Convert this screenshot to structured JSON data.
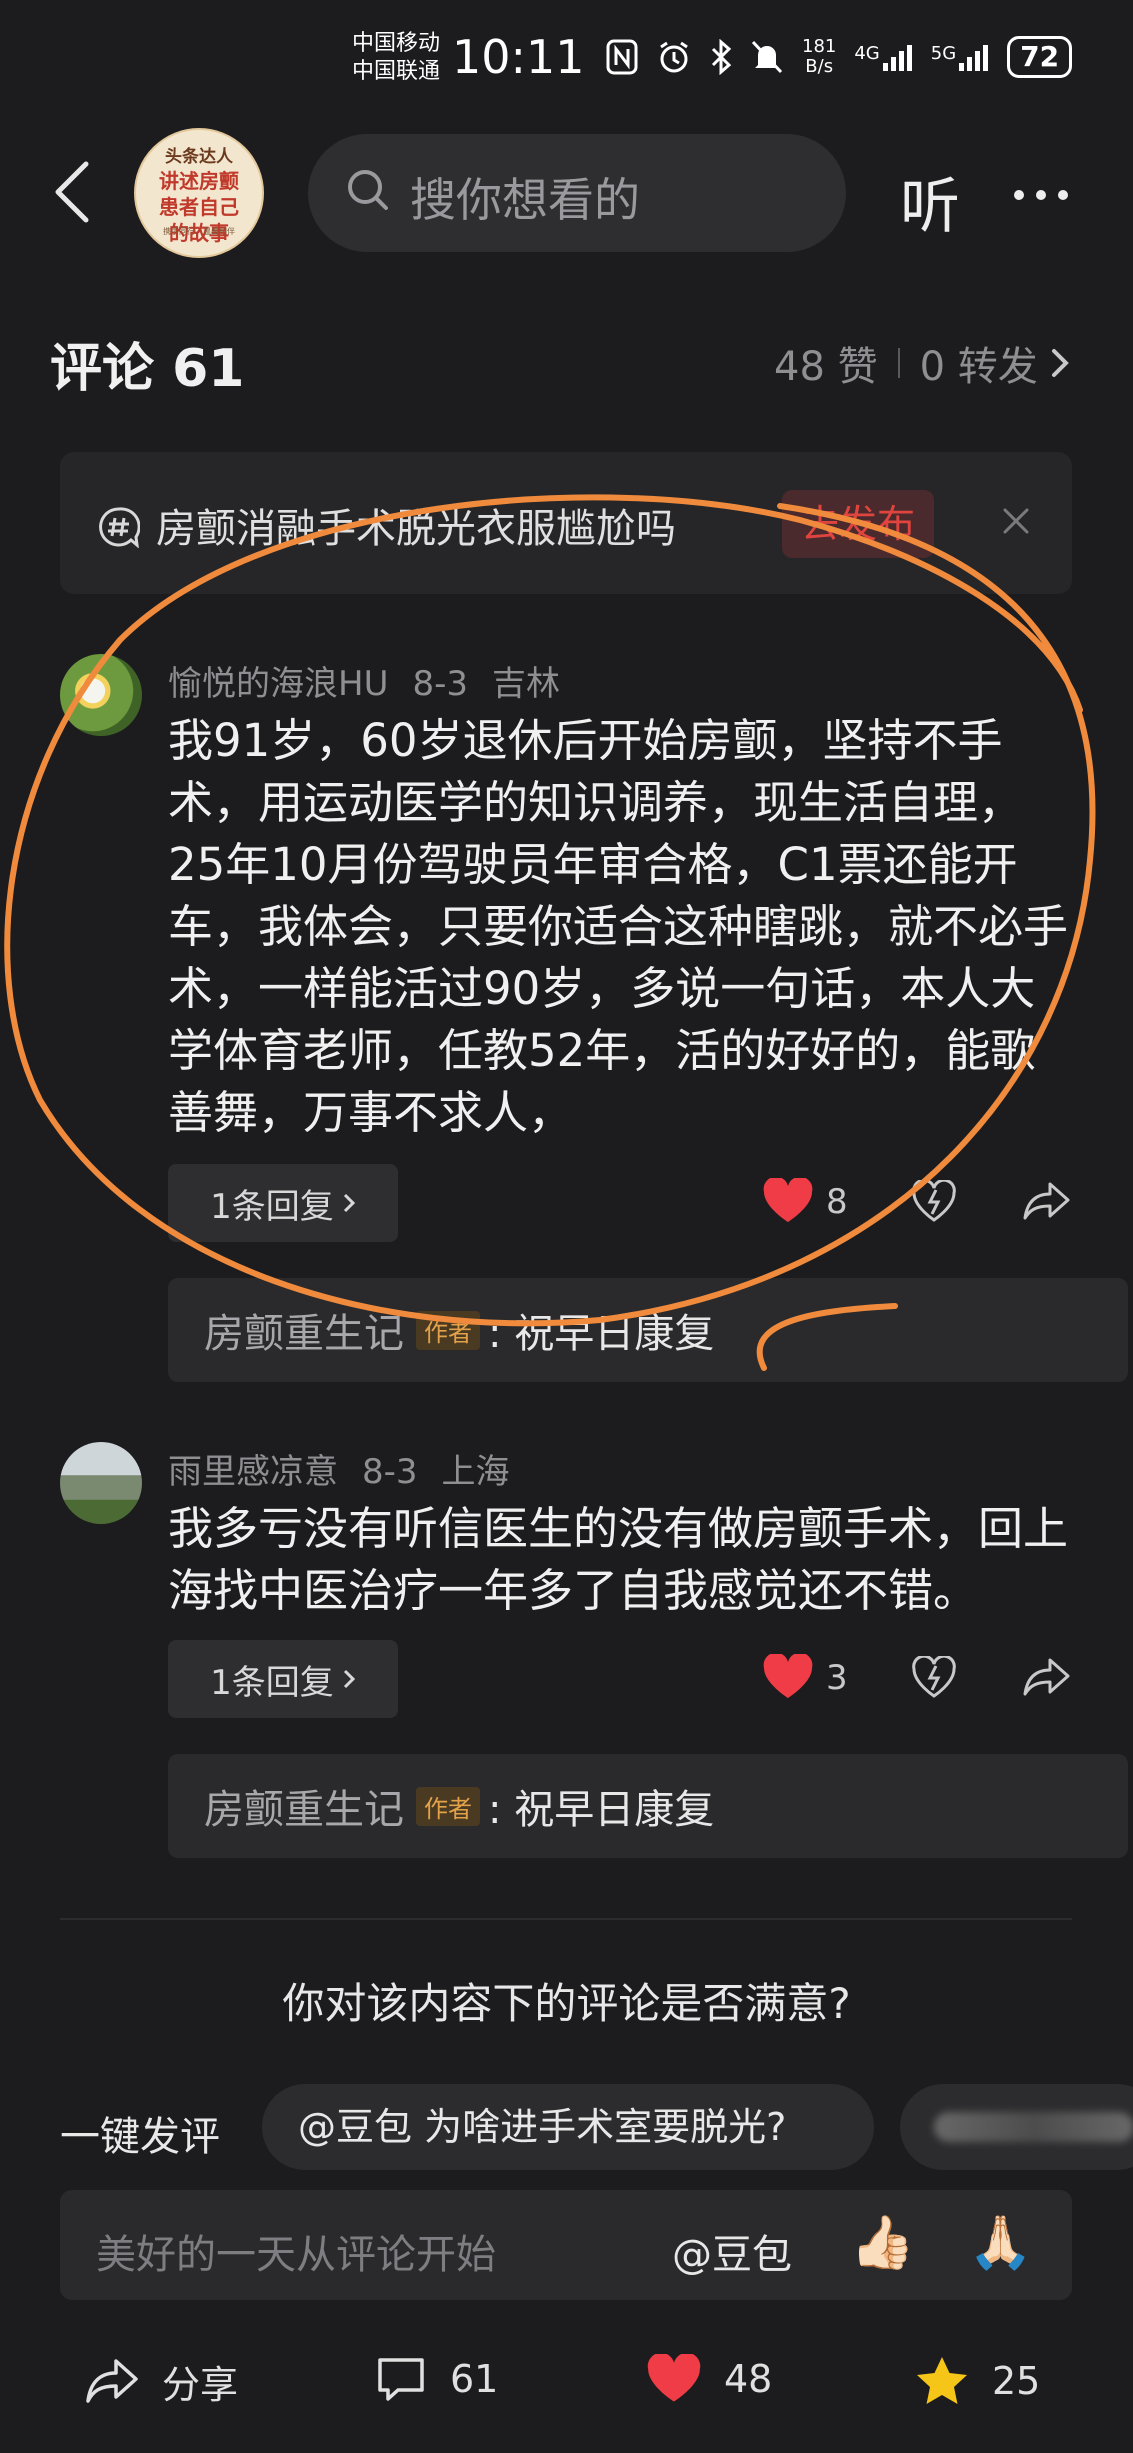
{
  "status_bar": {
    "carrier1": "中国移动",
    "carrier2": "中国联通",
    "time": "10:11",
    "net_speed_value": "181",
    "net_speed_unit": "B/s",
    "signal1": "4G",
    "signal2": "5G",
    "battery": "72"
  },
  "header": {
    "book_line1": "头条达人",
    "book_line2a": "讲述房颤",
    "book_line2b": "患者自己",
    "book_line2c": "的故事",
    "book_line3": "携手同行，温馨相伴",
    "search_placeholder": "搜你想看的",
    "listen_label": "听"
  },
  "comments_header": {
    "title": "评论 61",
    "likes": "48 赞",
    "forwards": "0 转发"
  },
  "topic_prompt": {
    "text": "房颤消融手术脱光衣服尴尬吗",
    "button": "去发布"
  },
  "comments": [
    {
      "user": "愉悦的海浪HU",
      "date": "8-3",
      "location": "吉林",
      "text": "我91岁，60岁退休后开始房颤，坚持不手术，用运动医学的知识调养，现生活自理，25年10月份驾驶员年审合格，C1票还能开车，我体会，只要你适合这种瞎跳，就不必手术，一样能活过90岁，多说一句话，本人大学体育老师，任教52年，活的好好的，能歌善舞，万事不求人，",
      "replies_label": "1条回复",
      "likes": "8",
      "sub_reply_author": "房颤重生记",
      "sub_reply_tag": "作者",
      "sub_reply_text": ": 祝早日康复"
    },
    {
      "user": "雨里感凉意",
      "date": "8-3",
      "location": "上海",
      "text": "我多亏没有听信医生的没有做房颤手术，回上海找中医治疗一年多了自我感觉还不错。",
      "replies_label": "1条回复",
      "likes": "3",
      "sub_reply_author": "房颤重生记",
      "sub_reply_tag": "作者",
      "sub_reply_text": ": 祝早日康复"
    }
  ],
  "survey_text": "你对该内容下的评论是否满意?",
  "quick_comment": {
    "label": "一键发评",
    "chip1": "@豆包 为啥进手术室要脱光?"
  },
  "input": {
    "placeholder": "美好的一天从评论开始",
    "mention": "@豆包",
    "emoji1": "👍🏻",
    "emoji2": "🙏🏻"
  },
  "bottom_bar": {
    "share": "分享",
    "comments": "61",
    "likes": "48",
    "favorites": "25"
  },
  "colors": {
    "background": "#1c1c1e",
    "like_red": "#f03c46",
    "star_yellow": "#f5c518",
    "annotation_orange": "#f08a3c"
  }
}
